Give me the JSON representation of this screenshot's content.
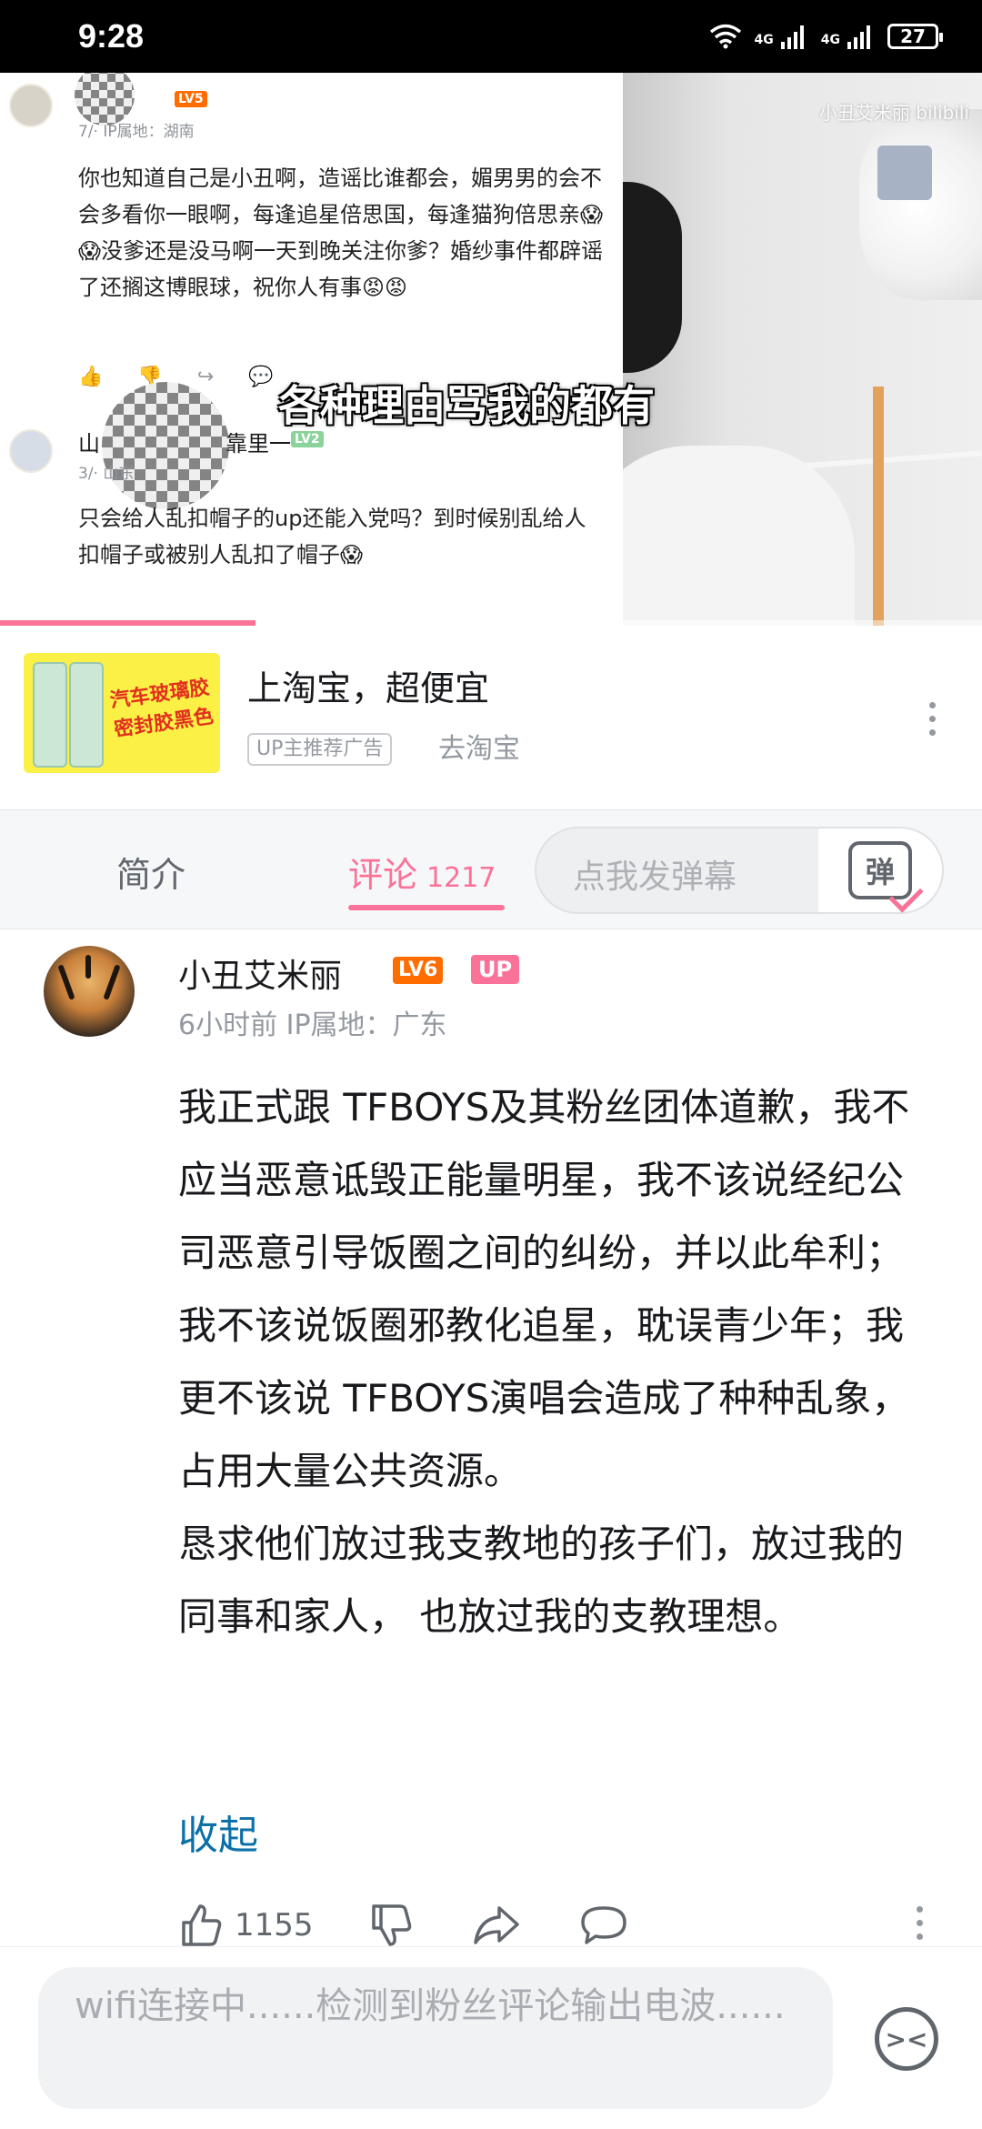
{
  "status_bar": {
    "time": "9:28",
    "signal_label_1": "4G",
    "signal_label_2": "4G",
    "battery": "27"
  },
  "video": {
    "watermark": "小丑艾米丽 bilibili",
    "danmaku_text": "各种理由骂我的都有",
    "progress": 0.26,
    "embedded_screenshot": {
      "comment1": {
        "name_suffix": "",
        "level": "LV5",
        "meta": "7/·  IP属地：湖南",
        "text": "你也知道自己是小丑啊，造谣比谁都会，媚男男的会不会多看你一眼啊，每逢追星倍思国，每逢猫狗倍思亲😱😱没爹还是没马啊一天到晚关注你爹？婚纱事件都辟谣了还搁这博眼球，祝你人有事😡😡"
      },
      "comment2": {
        "name_prefix": "山",
        "name_suffix": "靠里一",
        "level": "LV2",
        "meta": "3/·  山东",
        "text": "只会给人乱扣帽子的up还能入党吗？到时候别乱给人扣帽子或被别人乱扣了帽子😱"
      }
    }
  },
  "ad": {
    "thumb_text": "汽车玻璃胶密封胶黑色",
    "title": "上淘宝，超便宜",
    "badge": "UP主推荐广告",
    "link": "去淘宝"
  },
  "tabs": {
    "intro": "简介",
    "comments": "评论",
    "comments_count": "1217",
    "danmaku_placeholder": "点我发弹幕",
    "danmaku_icon_char": "弹"
  },
  "comment": {
    "author": "小丑艾米丽",
    "level": "LV6",
    "up_badge": "UP",
    "meta": "6小时前  IP属地：广东",
    "text": "我正式跟 TFBOYS及其粉丝团体道歉，我不应当恶意诋毁正能量明星，我不该说经纪公司恶意引导饭圈之间的纠纷，并以此牟利；我不该说饭圈邪教化追星，耽误青少年；我更不该说 TFBOYS演唱会造成了种种乱象，占用大量公共资源。\n恳求他们放过我支教地的孩子们，放过我的同事和家人， 也放过我的支教理想。",
    "collapse": "收起",
    "likes": "1155"
  },
  "reply": {
    "placeholder": "wifi连接中......检测到粉丝评论输出电波......"
  },
  "colors": {
    "accent": "#fb7299",
    "link": "#0b6fa8",
    "level_orange": "#ff6c00"
  }
}
